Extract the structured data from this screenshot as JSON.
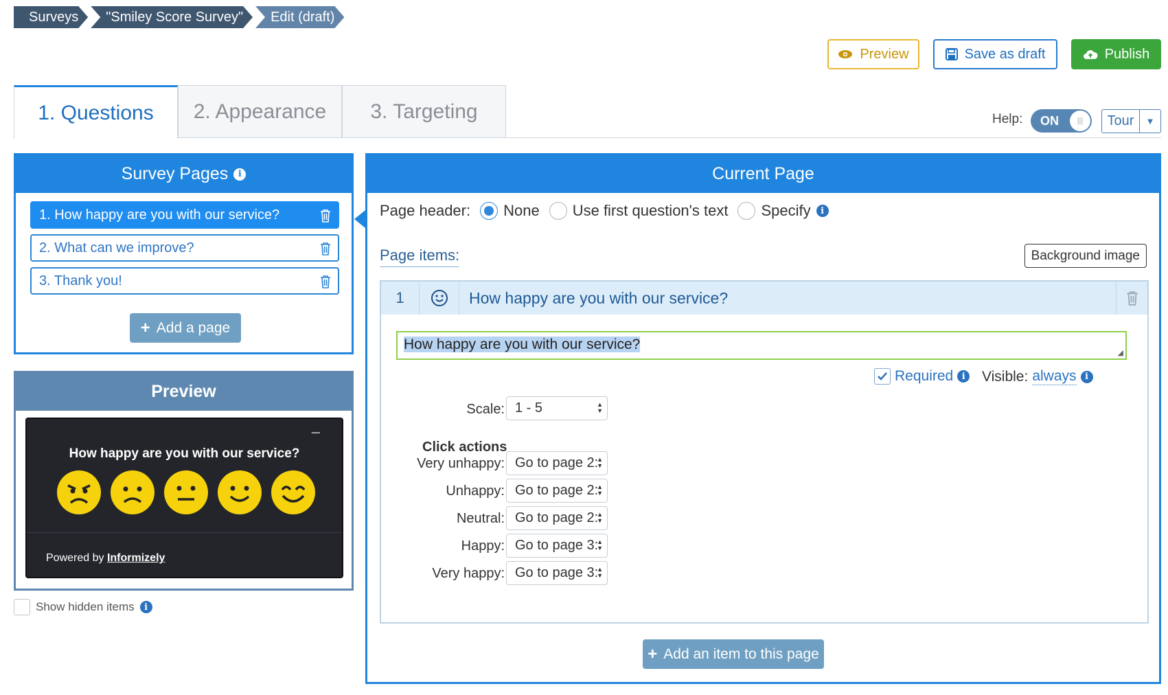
{
  "breadcrumb": [
    "Surveys",
    "\"Smiley Score Survey\"",
    "Edit (draft)"
  ],
  "toolbar": {
    "preview": "Preview",
    "save_draft": "Save as draft",
    "publish": "Publish"
  },
  "tabs": [
    "1. Questions",
    "2. Appearance",
    "3. Targeting"
  ],
  "help": {
    "label": "Help:",
    "toggle": "ON",
    "tour": "Tour"
  },
  "pages_panel": {
    "title": "Survey Pages",
    "items": [
      "1. How happy are you with our service?",
      "2. What can we improve?",
      "3. Thank you!"
    ],
    "add": "Add a page"
  },
  "preview_panel": {
    "title": "Preview",
    "minimize": "–",
    "question": "How happy are you with our service?",
    "powered_prefix": "Powered by",
    "powered_brand": "Informizely"
  },
  "show_hidden": "Show hidden items",
  "current_page": {
    "title": "Current Page",
    "header_label": "Page header:",
    "header_options": [
      "None",
      "Use first question's text",
      "Specify"
    ],
    "items_label": "Page items:",
    "bg_image": "Background image",
    "item": {
      "number": "1",
      "title": "How happy are you with our service?",
      "text": "How happy are you with our service?",
      "required": "Required",
      "visible_label": "Visible:",
      "visible_value": "always",
      "scale_label": "Scale:",
      "scale_value": "1 - 5",
      "click_actions": "Click actions",
      "actions": [
        {
          "label": "Very unhappy:",
          "value": "Go to page 2:"
        },
        {
          "label": "Unhappy:",
          "value": "Go to page 2:"
        },
        {
          "label": "Neutral:",
          "value": "Go to page 2:"
        },
        {
          "label": "Happy:",
          "value": "Go to page 3:"
        },
        {
          "label": "Very happy:",
          "value": "Go to page 3:"
        }
      ]
    },
    "add_item": "Add an item to this page"
  }
}
